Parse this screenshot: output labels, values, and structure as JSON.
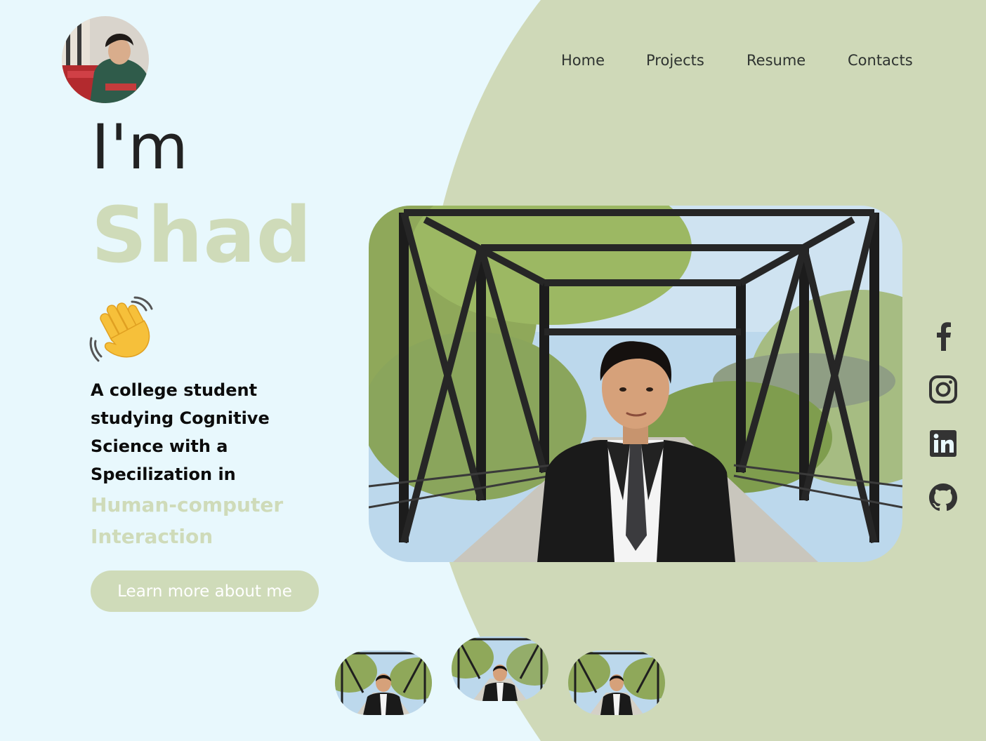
{
  "nav": {
    "items": [
      {
        "label": "Home"
      },
      {
        "label": "Projects"
      },
      {
        "label": "Resume"
      },
      {
        "label": "Contacts"
      }
    ]
  },
  "hero": {
    "greeting": "I'm",
    "name": "Shad",
    "bio_lines": [
      "A college student",
      "studying Cognitive",
      "Science with a",
      "Specilization in"
    ],
    "specialization_lines": [
      "Human-computer",
      "Interaction"
    ],
    "cta_label": "Learn more about me"
  },
  "social": {
    "icons": [
      "facebook-icon",
      "instagram-icon",
      "linkedin-icon",
      "github-icon"
    ]
  },
  "colors": {
    "background": "#e8f8fd",
    "accent_green": "#cfdbb9",
    "text_dark": "#2b2b2b"
  }
}
